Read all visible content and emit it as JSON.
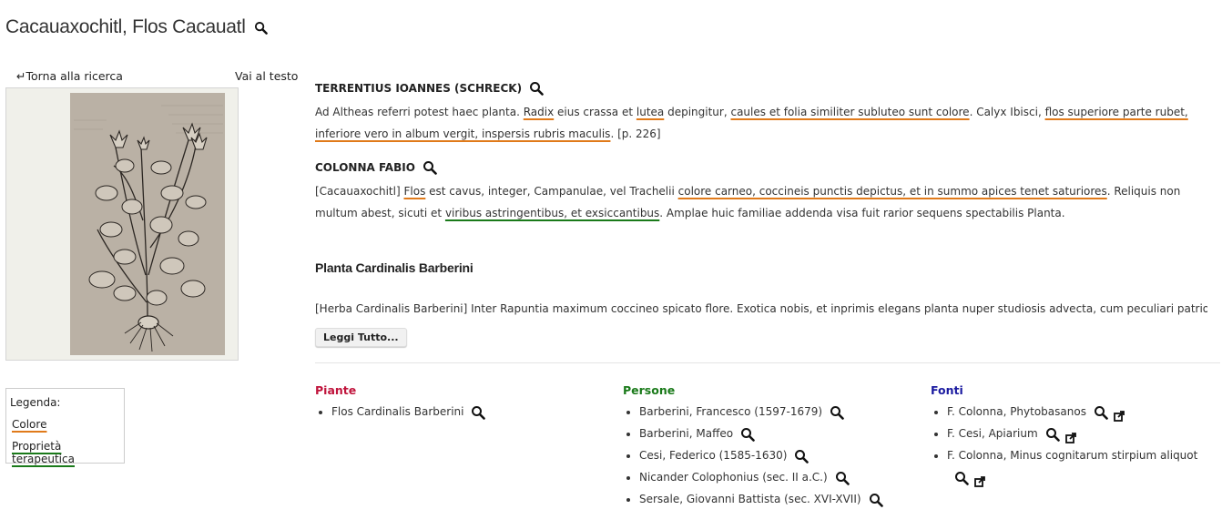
{
  "page": {
    "title": "Cacauaxochitl, Flos Cacauatl"
  },
  "nav": {
    "back": "Torna alla ricerca",
    "text": "Vai al testo"
  },
  "colors": {
    "colore": "#e07a1a",
    "proprieta": "#1a7a1a",
    "piante": "#c0143c",
    "persone": "#1a7a1a",
    "fonti": "#1a1aa0"
  },
  "entries": [
    {
      "author": "TERRENTIUS IOANNES (SCHRECK)",
      "segments": [
        {
          "t": "Ad Altheas referri potest haec planta. "
        },
        {
          "t": "Radix",
          "u": "or"
        },
        {
          "t": " eius crassa et "
        },
        {
          "t": "lutea",
          "u": "or"
        },
        {
          "t": " depingitur, "
        },
        {
          "t": "caules et folia similiter subluteo sunt colore",
          "u": "or"
        },
        {
          "t": ". Calyx Ibisci, "
        },
        {
          "t": "flos superiore parte rubet, inferiore vero in album vergit, inspersis rubris maculis",
          "u": "or"
        },
        {
          "t": ". [p. 226]"
        }
      ]
    },
    {
      "author": "COLONNA FABIO",
      "segments": [
        {
          "t": "[Cacauaxochitl] "
        },
        {
          "t": "Flos",
          "u": "or"
        },
        {
          "t": " est cavus, integer, Campanulae, vel Trachelii "
        },
        {
          "t": "colore carneo, coccineis punctis depictus, et in summo apices tenet saturiores",
          "u": "or"
        },
        {
          "t": ". Reliquis non multum abest, sicuti et "
        },
        {
          "t": "viribus astringentibus, et exsiccantibus",
          "u": "gr"
        },
        {
          "t": ". Amplae huic familiae addenda visa fuit rarior sequens spectabilis Planta."
        }
      ]
    }
  ],
  "section": {
    "title": "Planta Cardinalis Barberini",
    "excerpt": "[Herba Cardinalis Barberini] Inter Rapuntia maximum coccineo spicato flore. Exotica nobis, et inprimis elegans planta nuper studiosis advecta, cum peculiari patrioque nomine c...",
    "button": "Leggi Tutto..."
  },
  "columns": {
    "piante": {
      "title": "Piante",
      "items": [
        "Flos Cardinalis Barberini"
      ]
    },
    "persone": {
      "title": "Persone",
      "items": [
        "Barberini, Francesco (1597-1679)",
        "Barberini, Maffeo",
        "Cesi, Federico (1585-1630)",
        "Nicander Colophonius (sec. II a.C.)",
        "Sersale, Giovanni Battista (sec. XVI-XVII)"
      ]
    },
    "fonti": {
      "title": "Fonti",
      "items": [
        "F. Colonna, Phytobasanos",
        "F. Cesi, Apiarium",
        "F. Colonna, Minus cognitarum stirpium aliquot"
      ]
    }
  },
  "legend": {
    "title": "Legenda:",
    "colore": "Colore",
    "proprieta": "Proprietà terapeutica"
  }
}
